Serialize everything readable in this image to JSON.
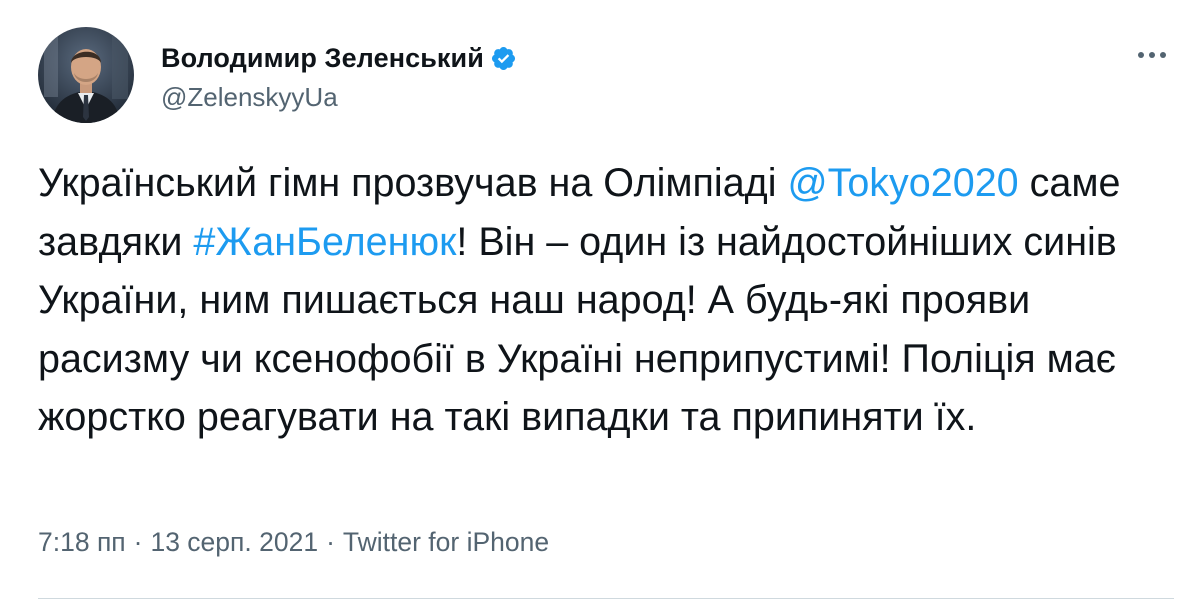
{
  "author": {
    "display_name": "Володимир Зеленський",
    "handle": "@ZelenskyyUa",
    "verified": true,
    "avatar_icon": "profile-photo-icon"
  },
  "tweet": {
    "segments": [
      {
        "text": "Український гімн прозвучав на Олімпіаді ",
        "type": "text"
      },
      {
        "text": "@Tokyo2020",
        "type": "mention"
      },
      {
        "text": " саме завдяки ",
        "type": "text"
      },
      {
        "text": "#ЖанБеленюк",
        "type": "hashtag"
      },
      {
        "text": "! Він – один із найдостойніших синів України, ним пишається наш народ! А будь-які прояви расизму чи ксенофобії в Україні неприпустимі! Поліція має жорстко реагувати на такі випадки та припиняти їх.",
        "type": "text"
      }
    ]
  },
  "meta": {
    "time": "7:18 пп",
    "separator": "·",
    "date": "13 серп. 2021",
    "source": "Twitter for iPhone"
  },
  "colors": {
    "link": "#1d9bf0",
    "secondary": "#536471",
    "verified": "#1d9bf0"
  },
  "icons": {
    "more": "more-options-icon",
    "verified": "verified-badge-icon"
  }
}
